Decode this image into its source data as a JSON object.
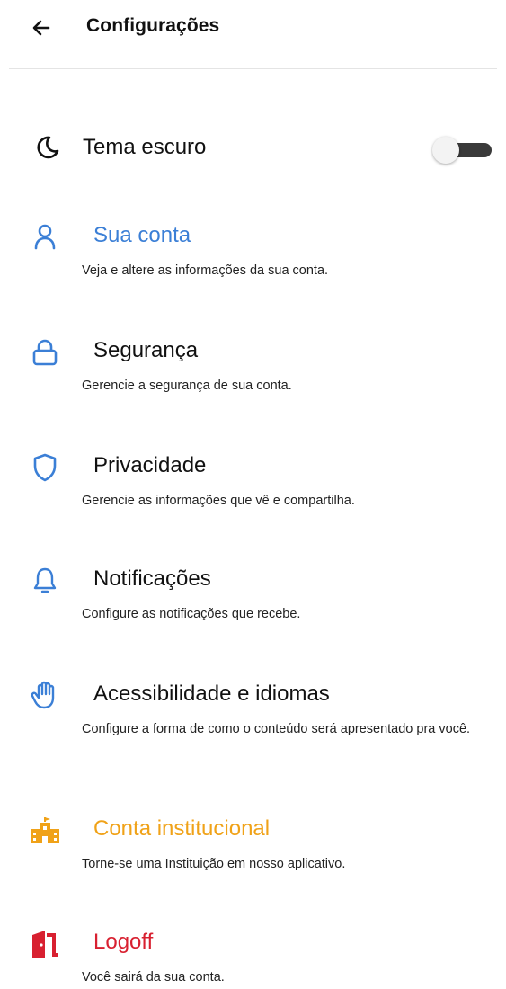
{
  "header": {
    "title": "Configurações",
    "back_icon": "arrow-left-icon"
  },
  "theme": {
    "label": "Tema escuro",
    "icon": "moon-icon",
    "enabled": false
  },
  "colors": {
    "blue": "#3b7fd6",
    "orange": "#f0a218",
    "red": "#d82030",
    "text": "#111111"
  },
  "items": [
    {
      "title": "Sua conta",
      "desc": "Veja e altere as informações da sua conta.",
      "icon": "user-icon"
    },
    {
      "title": "Segurança",
      "desc": "Gerencie a segurança de sua conta.",
      "icon": "lock-icon"
    },
    {
      "title": "Privacidade",
      "desc": "Gerencie as informações que vê e compartilha.",
      "icon": "shield-icon"
    },
    {
      "title": "Notificações",
      "desc": "Configure as notificações que recebe.",
      "icon": "bell-icon"
    },
    {
      "title": "Acessibilidade e idiomas",
      "desc": "Configure a forma de como o conteúdo será apresentado pra você.",
      "icon": "hand-icon"
    },
    {
      "title": "Conta institucional",
      "desc": "Torne-se uma Instituição em nosso aplicativo.",
      "icon": "building-icon"
    },
    {
      "title": "Logoff",
      "desc": "Você sairá da sua conta.",
      "icon": "door-exit-icon"
    }
  ]
}
